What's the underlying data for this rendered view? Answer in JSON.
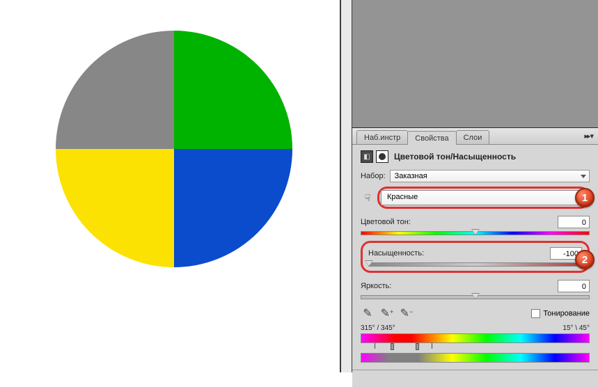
{
  "tabs": {
    "tools": "Наб.инстр",
    "properties": "Свойства",
    "layers": "Слои"
  },
  "panel": {
    "title": "Цветовой тон/Насыщенность"
  },
  "preset": {
    "label": "Набор:",
    "value": "Заказная"
  },
  "color_range": {
    "value": "Красные"
  },
  "hue": {
    "label": "Цветовой тон:",
    "value": "0"
  },
  "saturation": {
    "label": "Насыщенность:",
    "value": "-100"
  },
  "lightness": {
    "label": "Яркость:",
    "value": "0"
  },
  "colorize": {
    "label": "Тонирование"
  },
  "range": {
    "left": "315° / 345°",
    "right": "15° \\ 45°"
  },
  "callouts": {
    "one": "1",
    "two": "2"
  },
  "thumb_positions": {
    "hue": 50,
    "saturation": 0,
    "lightness": 50
  }
}
